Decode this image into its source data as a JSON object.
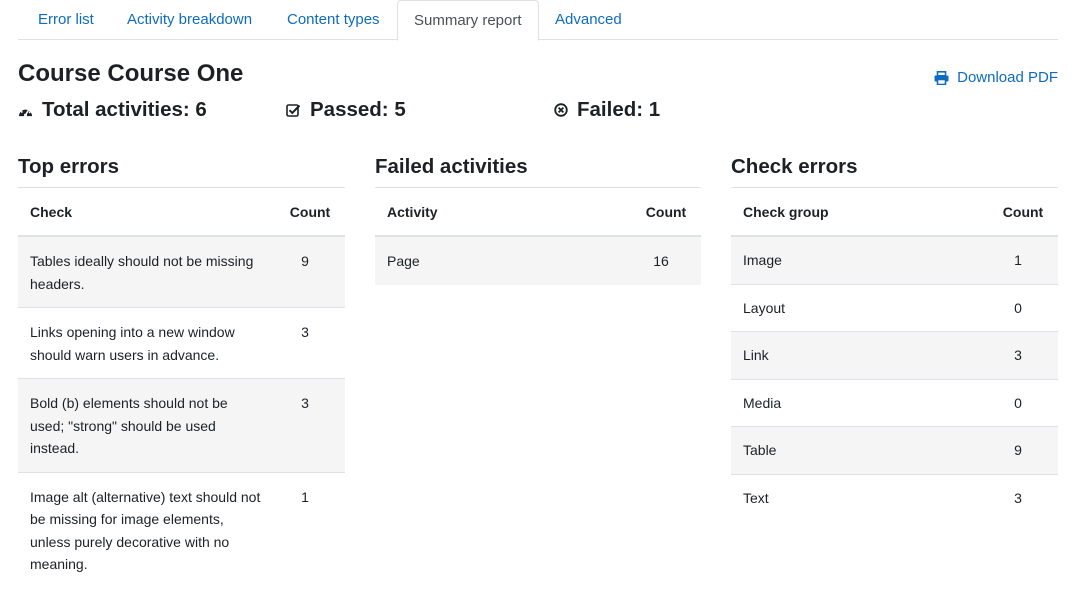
{
  "tabs": [
    {
      "label": "Error list"
    },
    {
      "label": "Activity breakdown"
    },
    {
      "label": "Content types"
    },
    {
      "label": "Summary report",
      "active": true
    },
    {
      "label": "Advanced"
    }
  ],
  "header": {
    "title": "Course Course One",
    "download_label": "Download PDF"
  },
  "stats": {
    "total": "Total activities: 6",
    "passed": "Passed: 5",
    "failed": "Failed: 1"
  },
  "top_errors": {
    "title": "Top errors",
    "columns": [
      "Check",
      "Count"
    ],
    "rows": [
      {
        "check": "Tables ideally should not be missing headers.",
        "count": "9"
      },
      {
        "check": "Links opening into a new window should warn users in advance.",
        "count": "3"
      },
      {
        "check": "Bold (b) elements should not be used; \"strong\" should be used instead.",
        "count": "3"
      },
      {
        "check": "Image alt (alternative) text should not be missing for image elements, unless purely decorative with no meaning.",
        "count": "1"
      }
    ]
  },
  "failed_activities": {
    "title": "Failed activities",
    "columns": [
      "Activity",
      "Count"
    ],
    "rows": [
      {
        "activity": "Page",
        "count": "16"
      }
    ]
  },
  "check_errors": {
    "title": "Check errors",
    "columns": [
      "Check group",
      "Count"
    ],
    "rows": [
      {
        "group": "Image",
        "count": "1"
      },
      {
        "group": "Layout",
        "count": "0"
      },
      {
        "group": "Link",
        "count": "3"
      },
      {
        "group": "Media",
        "count": "0"
      },
      {
        "group": "Table",
        "count": "9"
      },
      {
        "group": "Text",
        "count": "3"
      }
    ]
  },
  "colors": {
    "link": "#0f6cbf",
    "text": "#1d2125",
    "border": "#dee2e6",
    "stripe": "#f5f5f5"
  }
}
